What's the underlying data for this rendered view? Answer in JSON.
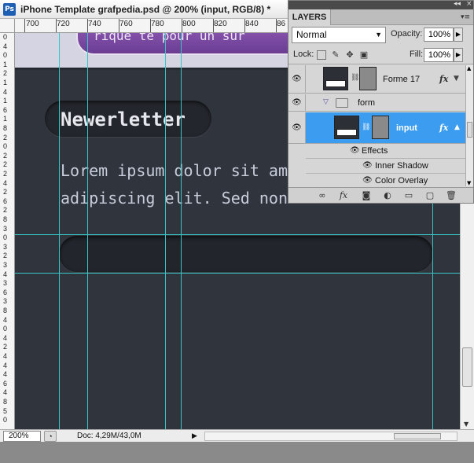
{
  "window": {
    "title": "iPhone Template grafpedia.psd @ 200% (input, RGB/8) *",
    "app_icon": "Ps"
  },
  "ruler": {
    "top_labels": [
      "700",
      "720",
      "740",
      "760",
      "780",
      "800",
      "820",
      "840",
      "86"
    ],
    "left_digits": [
      "0",
      "4",
      "0",
      "1",
      "2",
      "1",
      "4",
      "1",
      "6",
      "1",
      "8",
      "2",
      "0",
      "2",
      "2",
      "2",
      "4",
      "2",
      "6",
      "2",
      "8",
      "3",
      "0",
      "3",
      "2",
      "3",
      "4",
      "3",
      "6",
      "3",
      "8",
      "4",
      "0",
      "4",
      "2",
      "4",
      "4",
      "4",
      "6",
      "4",
      "8",
      "5",
      "0"
    ]
  },
  "canvas": {
    "top_text": "rique te pour un sur",
    "heading": "Newerletter",
    "lorem_lines": [
      "Lorem ipsum dolor sit am",
      "adipiscing elit. Sed non r"
    ]
  },
  "statusbar": {
    "zoom": "200%",
    "doc_info": "Doc: 4,29M/43,0M"
  },
  "layers_panel": {
    "tab": "LAYERS",
    "blend_mode": "Normal",
    "opacity_label": "Opacity:",
    "opacity_value": "100%",
    "lock_label": "Lock:",
    "fill_label": "Fill:",
    "fill_value": "100%",
    "layers": [
      {
        "name": "Forme 17",
        "fx": "fx"
      },
      {
        "name": "form"
      },
      {
        "name": "input",
        "fx": "fx",
        "selected": true
      }
    ],
    "effects_label": "Effects",
    "effects": [
      "Inner Shadow",
      "Color Overlay"
    ]
  }
}
